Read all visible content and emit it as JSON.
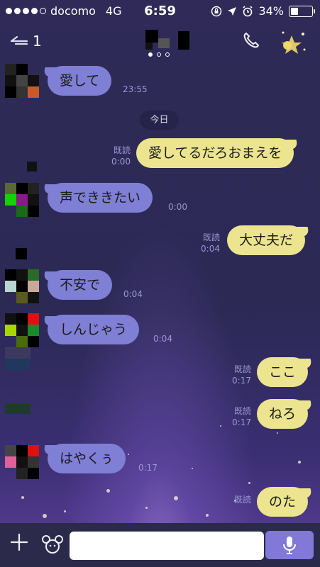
{
  "status_bar": {
    "carrier": "docomo",
    "network": "4G",
    "time": "6:59",
    "battery_percent": "34%",
    "battery_level": 0.34,
    "signal_bars": 4,
    "signal_max": 5
  },
  "nav": {
    "unread_count": "1",
    "page_dots": 3,
    "active_page": 1
  },
  "date_chip": "今日",
  "messages": [
    {
      "side": "in",
      "text": "愛して",
      "time": "23:55"
    },
    {
      "side": "out",
      "text": "愛してるだろおまえを",
      "read": "既読",
      "time": "0:00"
    },
    {
      "side": "in",
      "text": "声でききたい",
      "time": "0:00"
    },
    {
      "side": "out",
      "text": "大丈夫だ",
      "read": "既読",
      "time": "0:04"
    },
    {
      "side": "in",
      "text": "不安で",
      "time": "0:04"
    },
    {
      "side": "in",
      "text": "しんじゃう",
      "time": "0:04"
    },
    {
      "side": "out",
      "text": "ここ",
      "read": "既読",
      "time": "0:17"
    },
    {
      "side": "out",
      "text": "ねろ",
      "read": "既読",
      "time": "0:17"
    },
    {
      "side": "in",
      "text": "はやくぅ",
      "time": "0:17"
    },
    {
      "side": "out",
      "text": "のた",
      "read": "既読",
      "time": ""
    }
  ],
  "input": {
    "placeholder": ""
  },
  "icons": {
    "back": "back-arrow-icon",
    "call": "phone-icon",
    "plus": "plus-icon",
    "sticker": "sticker-icon",
    "mic": "microphone-icon"
  },
  "colors": {
    "incoming_bubble": "#7f7fd6",
    "outgoing_bubble": "#ece48f",
    "input_bar": "#2b2a4a",
    "mic_button": "#8178d8"
  }
}
